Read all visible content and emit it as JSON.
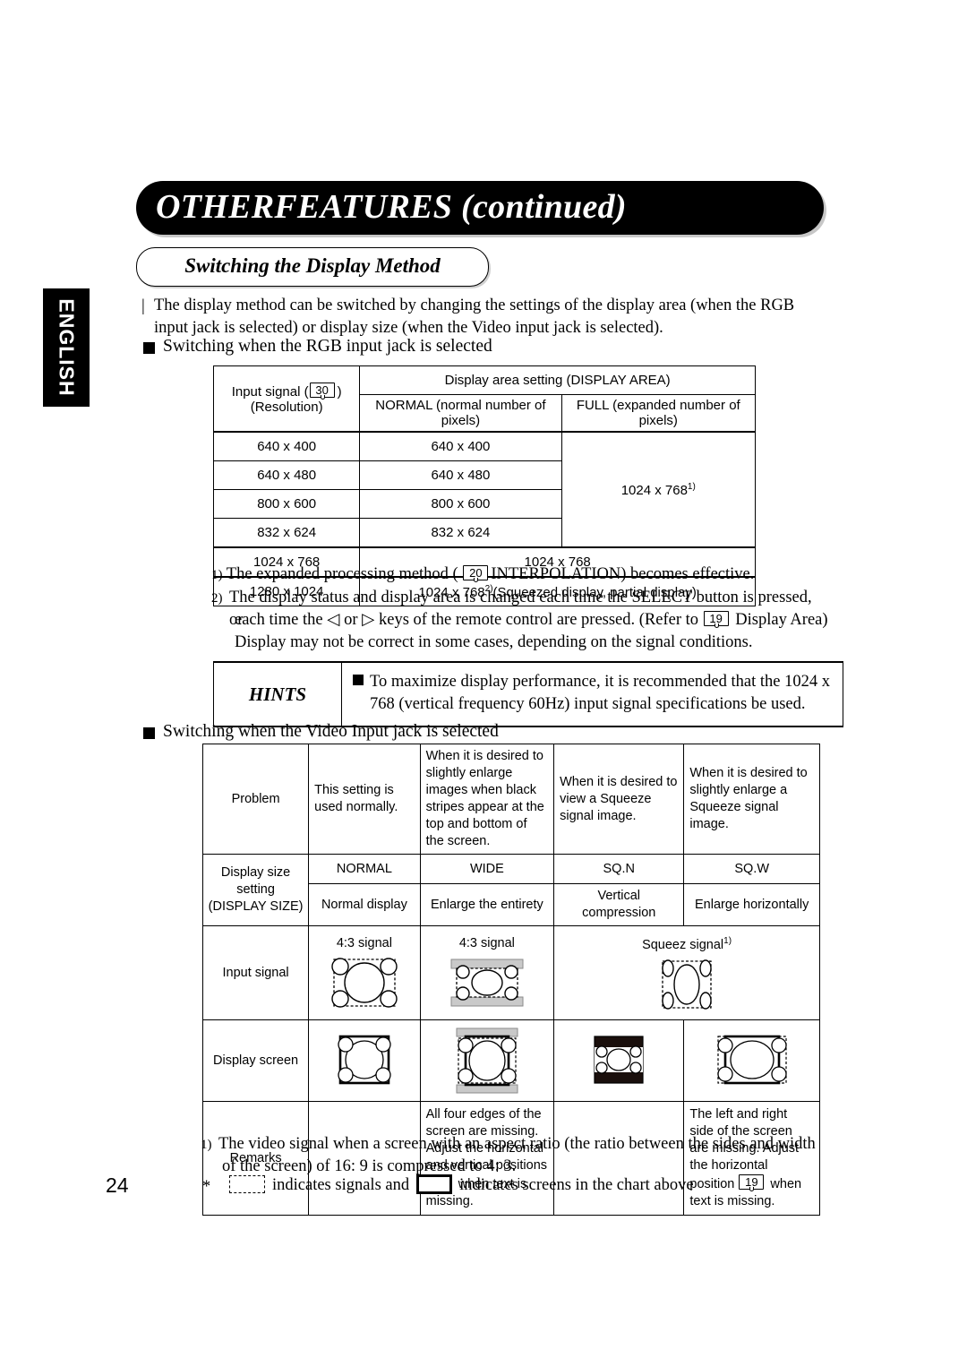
{
  "page": {
    "number": "24",
    "language_tab": "ENGLISH",
    "title": "OTHERFEATURES (continued)",
    "subtitle": "Switching the Display Method"
  },
  "intro": {
    "marker": "|",
    "text": "The display method can be switched by changing the settings of the display area (when the RGB input jack is selected) or display size (when the Video input jack is selected)."
  },
  "section_rgb": {
    "heading": "Switching when the RGB input jack is selected",
    "table": {
      "header_col1_line1": "Input signal (",
      "header_col1_ref": "30",
      "header_col1_line1_end": ")",
      "header_col1_line2": "(Resolution)",
      "header_group": "Display area setting (DISPLAY AREA)",
      "header_normal": "NORMAL (normal number of pixels)",
      "header_full": "FULL (expanded number of pixels)",
      "rows": [
        {
          "input": "640 x 400",
          "normal": "640 x 400"
        },
        {
          "input": "640 x 480",
          "normal": "640 x 480"
        },
        {
          "input": "800 x 600",
          "normal": "800 x 600"
        },
        {
          "input": "832 x 624",
          "normal": "832 x 624"
        }
      ],
      "full_merged": "1024 x 768",
      "full_merged_note": "1)",
      "row_1024": {
        "input": "1024 x 768",
        "span": "1024 x 768"
      },
      "row_1280": {
        "input": "1280 x 1024",
        "span_pre": "1024 x 768",
        "span_note": "2)",
        "span_post": "(Squeezed display, partial display)"
      }
    },
    "notes": [
      {
        "num": "1)",
        "pre": "The expanded processing method ( ",
        "ref": "20",
        "post": "INTERPOLATION) becomes effective."
      },
      {
        "num": "2)",
        "line1": "The display status and display area is changed each time the SELECT button is pressed, or",
        "line2_pre": "each time the ",
        "left_key": "◁",
        "line2_mid": " or ",
        "right_key": "▷",
        "line2_post": " keys of the remote control are pressed. (Refer to ",
        "ref": "19",
        "line2_end": " Display Area)",
        "line3": "Display may not be correct in some cases, depending on the signal conditions."
      }
    ]
  },
  "hints": {
    "label": "HINTS",
    "line1": "To maximize display performance, it is recommended that the 1024 x",
    "line2": "768 (vertical frequency 60Hz) input signal specifications be used."
  },
  "section_video": {
    "heading": "Switching when the Video Input jack is selected",
    "table": {
      "row_problem_label": "Problem",
      "problems": [
        "This setting is used normally.",
        "When it is desired to slightly enlarge images when black stripes appear at the top and bottom of the screen.",
        "When it is desired to view a Squeeze signal image.",
        "When it is desired to slightly enlarge a Squeeze signal image."
      ],
      "row_setting_label_line1": "Display size setting",
      "row_setting_label_line2": "(DISPLAY SIZE)",
      "settings": [
        "NORMAL",
        "WIDE",
        "SQ.N",
        "SQ.W"
      ],
      "setting_descriptions": [
        "Normal display",
        "Enlarge the entirety",
        "Vertical compression",
        "Enlarge horizontally"
      ],
      "row_input_label": "Input signal",
      "input_signal_labels": [
        "4:3 signal",
        "4:3 signal"
      ],
      "input_signal_squeeze_label": "Squeez signal",
      "input_signal_squeeze_note": "1)",
      "row_display_label": "Display screen",
      "row_remarks_label": "Remarks",
      "remarks": [
        "",
        "All four edges of the screen are missing. Adjust the horizontal and vertical positions",
        "",
        "The left and right side of the screen are missing. Adjust the horizontal position"
      ],
      "remark2_ref": "19",
      "remark2_tail": "when text is missing.",
      "remark4_ref": "19",
      "remark4_tail": "when text is missing."
    }
  },
  "footnotes": {
    "note1_num": "1)",
    "note1_line1": "The video signal when a screen with an aspect ratio (the ratio between the sides and width",
    "note1_line2": "of the screen) of 16: 9 is compressed to 4: 3.",
    "legend_star": "*",
    "legend_dash_text": "indicates signals and",
    "legend_solid_text": "indicates screens in the chart above"
  }
}
